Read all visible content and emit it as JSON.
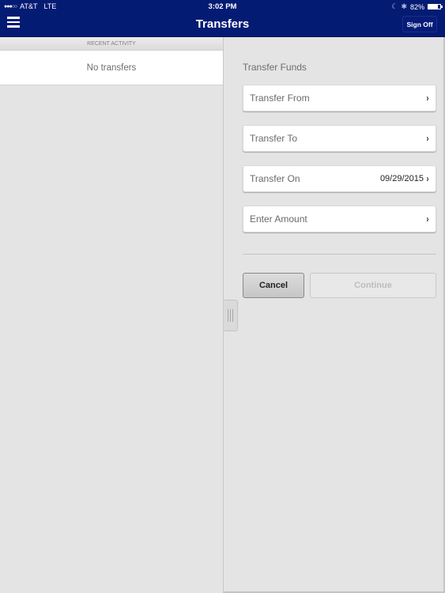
{
  "status_bar": {
    "signal": "●●●○○",
    "carrier": "AT&T",
    "network": "LTE",
    "time": "3:02 PM",
    "moon_icon": "☾",
    "bluetooth_icon": "✱",
    "battery_percent": "82%",
    "battery_level": 0.82
  },
  "header": {
    "title": "Transfers",
    "sign_off_label": "Sign Off"
  },
  "recent_activity": {
    "header": "RECENT ACTIVITY",
    "empty_message": "No transfers"
  },
  "transfer_form": {
    "title": "Transfer Funds",
    "fields": [
      {
        "label": "Transfer From",
        "value": ""
      },
      {
        "label": "Transfer To",
        "value": ""
      },
      {
        "label": "Transfer On",
        "value": "09/29/2015"
      },
      {
        "label": "Enter Amount",
        "value": ""
      }
    ],
    "chevron": "›",
    "cancel_label": "Cancel",
    "continue_label": "Continue"
  },
  "colors": {
    "brand_navy": "#041b74",
    "background": "#e4e4e4"
  }
}
